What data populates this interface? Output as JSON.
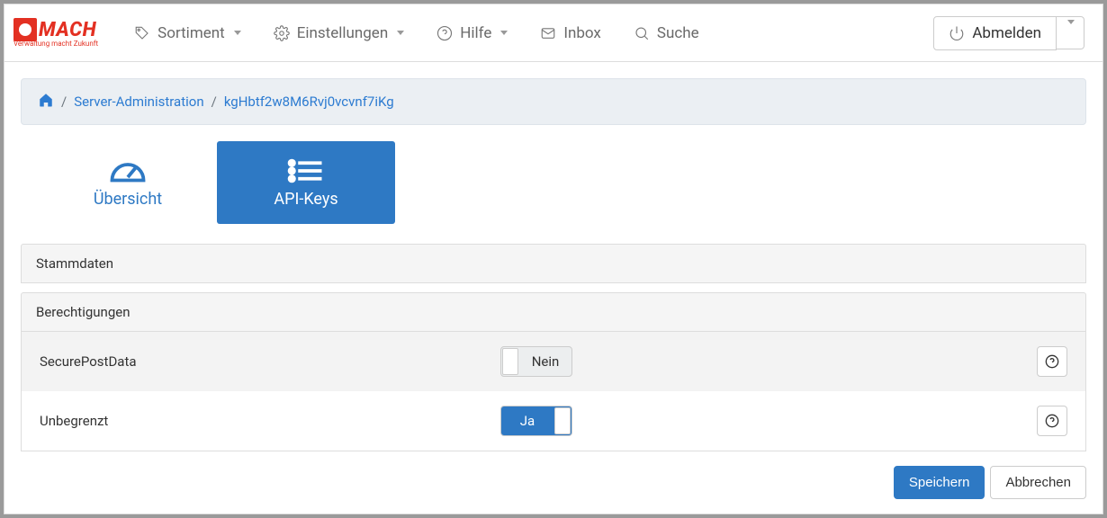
{
  "logo": {
    "text": "MACH",
    "subtitle": "Verwaltung macht Zukunft"
  },
  "nav": {
    "sortiment": "Sortiment",
    "einstellungen": "Einstellungen",
    "hilfe": "Hilfe",
    "inbox": "Inbox",
    "suche": "Suche",
    "abmelden": "Abmelden"
  },
  "breadcrumb": {
    "seg1": "Server-Administration",
    "seg2": "kgHbtf2w8M6Rvj0vcvnf7iKg"
  },
  "tabs": {
    "overview": "Übersicht",
    "apikeys": "API-Keys"
  },
  "sections": {
    "stammdaten": "Stammdaten",
    "berechtigungen": "Berechtigungen"
  },
  "permissions": {
    "securePostData": {
      "label": "SecurePostData",
      "value": "Nein"
    },
    "unbegrenzt": {
      "label": "Unbegrenzt",
      "value": "Ja"
    }
  },
  "actions": {
    "save": "Speichern",
    "cancel": "Abbrechen"
  }
}
